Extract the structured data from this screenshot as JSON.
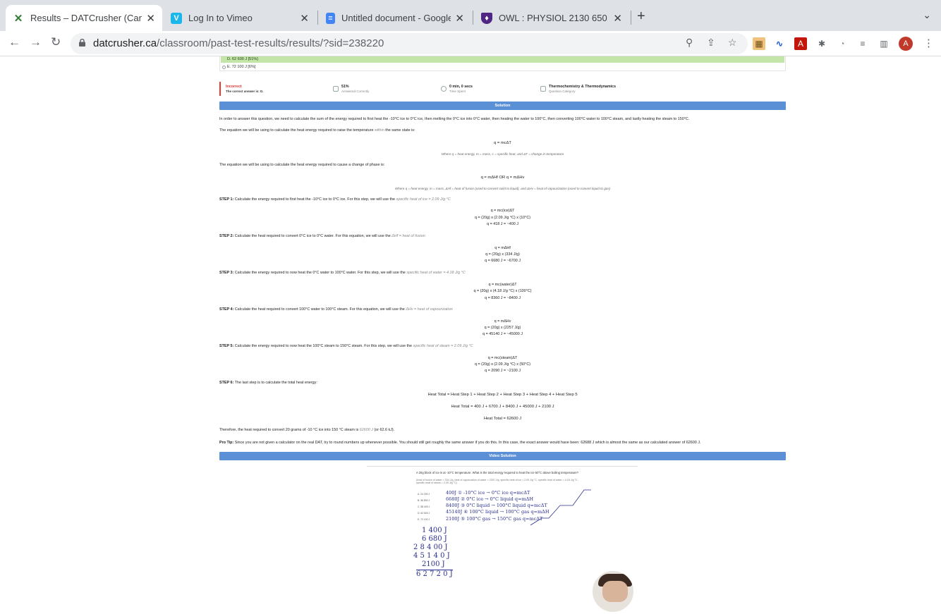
{
  "tabs": [
    {
      "title": "Results – DATCrusher (Canada",
      "icon": "datcrusher-x-icon"
    },
    {
      "title": "Log In to Vimeo",
      "icon": "vimeo-icon"
    },
    {
      "title": "Untitled document - Google Do",
      "icon": "google-docs-icon"
    },
    {
      "title": "OWL : PHYSIOL 2130 650 SU2",
      "icon": "owl-shield-icon"
    }
  ],
  "url": {
    "host": "datcrusher.ca",
    "path": "/classroom/past-test-results/results/?sid=238220"
  },
  "profile_initial": "A",
  "options": {
    "d": "D. 62 600 J [51%]",
    "e": "E. 72 100 J [6%]"
  },
  "result": {
    "status": "Incorrect",
    "correct_answer": "The correct answer is: D.",
    "percent": "51%",
    "percent_label": "Answered Correctly",
    "time": "0 min, 0 secs",
    "time_label": "Time Spent",
    "category": "Thermochemistry & Thermodynamics",
    "category_label": "Question Category"
  },
  "solution": {
    "header": "Solution",
    "intro": "In order to answer this question, we need to calculate the sum of the energy required to first heat the -10°C ice to 0°C ice, then melting the 0°C ice into 0°C water, then heating the water to 100°C, then converting 100°C water to 100°C steam, and lastly heating the steam to 150°C.",
    "eq1_intro_a": "The equation we will be using to calculate the heat energy required to raise the temperature ",
    "eq1_intro_hl": "within",
    "eq1_intro_b": " the same state is:",
    "eq1": "q = mcΔT",
    "eq1_note": "Where q = heat energy, m = mass, c = specific heat, and ΔT = change in temperature",
    "eq2_intro": "The equation we will be using to calculate the heat energy required to cause a change of phase is:",
    "eq2": "q = mΔHf     OR     q = mΔHv",
    "eq2_note": "Where q = heat energy, m = mass, ΔHf = heat of fusion (used to convert solid to liquid), and ΔHv = heat of vapourization (used to convert liquid to gas)",
    "step1_label": "STEP 1:",
    "step1_text": " Calculate the energy required to first heat the -10°C ice to 0°C ice. For this step, we will use the ",
    "step1_hl": "specific heat of ice = 2.09 J/g °C",
    "step1_eqs": [
      "q = mc(ice)ΔT",
      "q = (20g) x (2.09 J/g °C) x (10°C)",
      "q = 418 J = ~400 J"
    ],
    "step2_label": "STEP 2:",
    "step2_text": " Calculate the heat required to convert 0°C ice to 0°C water. For this equation, we will use the ",
    "step2_hl": "ΔHf = heat of fusion",
    "step2_eqs": [
      "q = mΔHf",
      "q = (20g) x (334 J/g)",
      "q = 6680 J = ~6700 J"
    ],
    "step3_label": "STEP 3:",
    "step3_text": " Calculate the energy required to now heat the 0°C water to 100°C water. For this step, we will use the ",
    "step3_hl": "specific heat of water = 4.18 J/g °C",
    "step3_eqs": [
      "q = mc(water)ΔT",
      "q = (20g) x (4.18 J/g °C) x (100°C)",
      "q = 8360 J = ~8400 J"
    ],
    "step4_label": "STEP 4:",
    "step4_text": " Calculate the heat required to convert 100°C water to 100°C steam. For this equation, we will use the ",
    "step4_hl": "ΔHv = heat of vapourization",
    "step4_eqs": [
      "q = mΔHv",
      "q = (20g) x (2257 J/g)",
      "q = 45140 J = ~45000 J"
    ],
    "step5_label": "STEP 5:",
    "step5_text": " Calculate the energy required to now heat the 100°C steam to 150°C steam. For this step, we will use the ",
    "step5_hl": "specific heat of steam = 2.09 J/g °C",
    "step5_eqs": [
      "q = mc(steam)ΔT",
      "q = (20g) x (2.09 J/g °C) x (50°C)",
      "q = 2090 J = ~2100 J"
    ],
    "step6_label": "STEP 6:",
    "step6_text": " The last step is to calculate the total heat energy:",
    "total_eq1": "Heat Total = Heat Step 1 + Heat Step 2 + Heat Step 3 + Heat Step 4 + Heat Step 5",
    "total_eq2": "Heat Total = 400 J + 6700 J + 8400 J + 45000 J + 2100 J",
    "total_eq3": "Heat Total = 62600 J",
    "conclusion_a": "Therefore, the heat required to convert 20 grams of -10 °C ice into 150 °C steam is ",
    "conclusion_hl": "62600 J",
    "conclusion_b": " (or 62.6 kJ).",
    "protip_label": "Pro Tip:",
    "protip_text": " Since you are not given a calculator on the real DAT, try to round numbers up whenever possible. You should still get roughly the same answer if you do this. In this case, the exact answer would have been: 62688 J which is almost the same as our calculated answer of 62600 J."
  },
  "video": {
    "header": "Video Solution",
    "question": "A 20g block of ice is at -10°C temperature. What is the total energy required to heat the ice 50°C above boiling temperature?",
    "given": "(heat of fusion of water = 334 J/g, heat of vaporization of water = 2257 J/g, specific heat of ice = 2.09 J/g °C, specific heat of water = 4.18 J/g °C, specific heat of steam = 2.09 J/g °C)",
    "options": [
      "A. 24 200 J",
      "B. 36 800 J",
      "C. 58 400 J",
      "D. 62 600 J",
      "E. 72 100 J"
    ],
    "handwriting": [
      "400J ① -10°C ice → 0°C ice  q=mcΔT",
      "6680J ② 0°C ice → 0°C liquid  q=mΔH",
      "8400J ③ 0°C liquid → 100°C liquid  q=mcΔT",
      "45140J ④ 100°C liquid → 100°C gas  q=mΔH",
      "2100J ⑤ 100°C gas → 150°C gas  q=mcΔT"
    ],
    "sum": [
      "1 400 J",
      "6 680 J",
      "2 8 4 00 J",
      "4 5 1 4 0 J",
      "2100 J",
      "6 2 7 2 0 J"
    ]
  }
}
